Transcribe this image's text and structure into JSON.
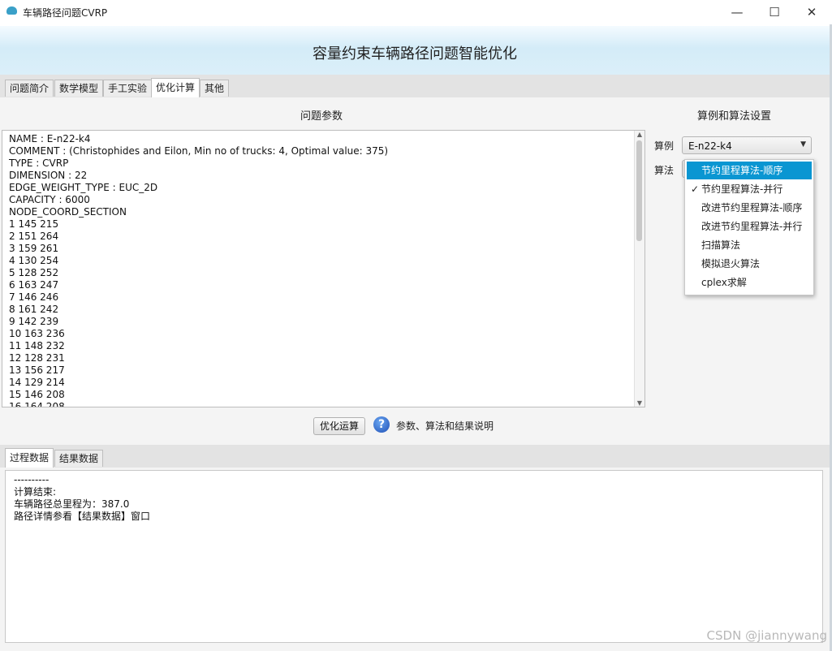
{
  "window": {
    "title": "车辆路径问题CVRP",
    "minimize": "—",
    "maximize": "☐",
    "close": "✕"
  },
  "banner": {
    "title": "容量约束车辆路径问题智能优化"
  },
  "tabs": [
    {
      "label": "问题简介",
      "active": false
    },
    {
      "label": "数学模型",
      "active": false
    },
    {
      "label": "手工实验",
      "active": false
    },
    {
      "label": "优化计算",
      "active": true
    },
    {
      "label": "其他",
      "active": false
    }
  ],
  "params": {
    "heading": "问题参数",
    "lines": [
      "NAME : E-n22-k4",
      "COMMENT : (Christophides and Eilon, Min no of trucks: 4, Optimal value: 375)",
      "TYPE : CVRP",
      "DIMENSION : 22",
      "EDGE_WEIGHT_TYPE : EUC_2D",
      "CAPACITY : 6000",
      "NODE_COORD_SECTION",
      "1 145 215",
      "2 151 264",
      "3 159 261",
      "4 130 254",
      "5 128 252",
      "6 163 247",
      "7 146 246",
      "8 161 242",
      "9 142 239",
      "10 163 236",
      "11 148 232",
      "12 128 231",
      "13 156 217",
      "14 129 214",
      "15 146 208",
      "16 164 208"
    ]
  },
  "settings": {
    "heading": "算例和算法设置",
    "instance_label": "算例",
    "instance_value": "E-n22-k4",
    "algorithm_label": "算法",
    "algorithm_options": [
      {
        "label": "节约里程算法-顺序",
        "highlighted": true,
        "checked": false
      },
      {
        "label": "节约里程算法-并行",
        "highlighted": false,
        "checked": true
      },
      {
        "label": "改进节约里程算法-顺序",
        "highlighted": false,
        "checked": false
      },
      {
        "label": "改进节约里程算法-并行",
        "highlighted": false,
        "checked": false
      },
      {
        "label": "扫描算法",
        "highlighted": false,
        "checked": false
      },
      {
        "label": "模拟退火算法",
        "highlighted": false,
        "checked": false
      },
      {
        "label": "cplex求解",
        "highlighted": false,
        "checked": false
      }
    ]
  },
  "actions": {
    "run_label": "优化运算",
    "help_icon": "question-circle-icon",
    "help_text": "参数、算法和结果说明"
  },
  "output_tabs": [
    {
      "label": "过程数据",
      "active": true
    },
    {
      "label": "结果数据",
      "active": false
    }
  ],
  "output": {
    "lines": [
      "----------",
      "计算结束:",
      "车辆路径总里程为：387.0",
      "路径详情参看【结果数据】窗口"
    ]
  },
  "watermark": "CSDN @jiannywang"
}
